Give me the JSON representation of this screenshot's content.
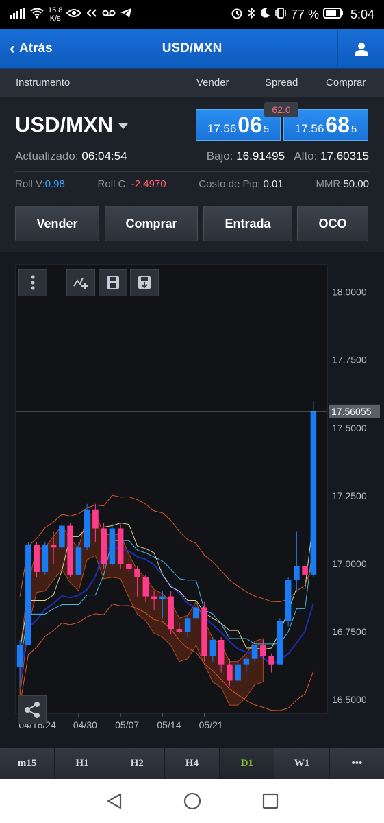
{
  "status_bar": {
    "net_speed": "15.8",
    "net_unit": "K/s",
    "battery": "77 %",
    "time": "5:04"
  },
  "nav": {
    "back_label": "Atrás",
    "title": "USD/MXN"
  },
  "columns": {
    "instrument": "Instrumento",
    "sell": "Vender",
    "spread": "Spread",
    "buy": "Comprar"
  },
  "instrument": {
    "name": "USD/MXN",
    "spread": "62.0",
    "sell_price": {
      "prefix": "17.56",
      "big": "06",
      "sup": "5"
    },
    "buy_price": {
      "prefix": "17.56",
      "big": "68",
      "sup": "5"
    },
    "updated_label": "Actualizado:",
    "updated_value": "06:04:54",
    "low_label": "Bajo:",
    "low_value": "16.91495",
    "high_label": "Alto:",
    "high_value": "17.60315",
    "roll_v_label": "Roll V:",
    "roll_v_value": "0.98",
    "roll_c_label": "Roll C:",
    "roll_c_value": "-2.4970",
    "pip_cost_label": "Costo de Pip:",
    "pip_cost_value": "0.01",
    "mmr_label": "MMR:",
    "mmr_value": "50.00"
  },
  "actions": {
    "sell": "Vender",
    "buy": "Comprar",
    "entry": "Entrada",
    "oco": "OCO"
  },
  "timeframes": [
    "m15",
    "H1",
    "H2",
    "H4",
    "D1",
    "W1",
    "•••"
  ],
  "active_timeframe": "D1",
  "chart_data": {
    "type": "candlestick",
    "y_ticks": [
      "18.0000",
      "17.7500",
      "17.5000",
      "17.2500",
      "17.0000",
      "16.7500",
      "16.5000"
    ],
    "x_ticks": [
      "04/16/24",
      "04/30",
      "05/07",
      "05/14",
      "05/21"
    ],
    "current_price_label": "17.56055",
    "current_price": 17.56055,
    "ylim": [
      16.45,
      18.1
    ],
    "candles": [
      {
        "o": 16.62,
        "h": 16.72,
        "c": 16.7,
        "l": 16.55
      },
      {
        "o": 16.7,
        "h": 17.08,
        "c": 17.07,
        "l": 16.7
      },
      {
        "o": 17.07,
        "h": 17.08,
        "c": 16.97,
        "l": 16.95
      },
      {
        "o": 16.97,
        "h": 17.08,
        "c": 17.07,
        "l": 16.96
      },
      {
        "o": 17.07,
        "h": 17.12,
        "c": 17.06,
        "l": 17.0
      },
      {
        "o": 17.06,
        "h": 17.15,
        "c": 17.14,
        "l": 17.05
      },
      {
        "o": 17.14,
        "h": 17.15,
        "c": 16.96,
        "l": 16.95
      },
      {
        "o": 16.96,
        "h": 17.08,
        "c": 17.06,
        "l": 16.96
      },
      {
        "o": 17.06,
        "h": 17.22,
        "c": 17.2,
        "l": 17.05
      },
      {
        "o": 17.2,
        "h": 17.22,
        "c": 17.13,
        "l": 17.08
      },
      {
        "o": 17.13,
        "h": 17.15,
        "c": 17.0,
        "l": 16.98
      },
      {
        "o": 17.0,
        "h": 17.15,
        "c": 17.13,
        "l": 16.99
      },
      {
        "o": 17.13,
        "h": 17.15,
        "c": 17.0,
        "l": 16.98
      },
      {
        "o": 17.0,
        "h": 17.02,
        "c": 16.98,
        "l": 16.97
      },
      {
        "o": 16.98,
        "h": 16.99,
        "c": 16.95,
        "l": 16.88
      },
      {
        "o": 16.95,
        "h": 16.96,
        "c": 16.88,
        "l": 16.86
      },
      {
        "o": 16.88,
        "h": 16.9,
        "c": 16.87,
        "l": 16.83
      },
      {
        "o": 16.87,
        "h": 16.9,
        "c": 16.88,
        "l": 16.8
      },
      {
        "o": 16.88,
        "h": 16.9,
        "c": 16.76,
        "l": 16.74
      },
      {
        "o": 16.76,
        "h": 16.78,
        "c": 16.75,
        "l": 16.74
      },
      {
        "o": 16.75,
        "h": 16.81,
        "c": 16.8,
        "l": 16.73
      },
      {
        "o": 16.8,
        "h": 16.86,
        "c": 16.84,
        "l": 16.78
      },
      {
        "o": 16.84,
        "h": 16.86,
        "c": 16.66,
        "l": 16.64
      },
      {
        "o": 16.66,
        "h": 16.73,
        "c": 16.72,
        "l": 16.64
      },
      {
        "o": 16.72,
        "h": 16.73,
        "c": 16.63,
        "l": 16.6
      },
      {
        "o": 16.63,
        "h": 16.65,
        "c": 16.57,
        "l": 16.55
      },
      {
        "o": 16.57,
        "h": 16.64,
        "c": 16.63,
        "l": 16.56
      },
      {
        "o": 16.63,
        "h": 16.66,
        "c": 16.65,
        "l": 16.6
      },
      {
        "o": 16.65,
        "h": 16.71,
        "c": 16.7,
        "l": 16.64
      },
      {
        "o": 16.7,
        "h": 16.72,
        "c": 16.66,
        "l": 16.65
      },
      {
        "o": 16.66,
        "h": 16.67,
        "c": 16.63,
        "l": 16.6
      },
      {
        "o": 16.63,
        "h": 16.8,
        "c": 16.79,
        "l": 16.63
      },
      {
        "o": 16.79,
        "h": 16.95,
        "c": 16.94,
        "l": 16.77
      },
      {
        "o": 16.94,
        "h": 17.12,
        "c": 16.99,
        "l": 16.9
      },
      {
        "o": 16.99,
        "h": 17.05,
        "c": 16.96,
        "l": 16.93
      },
      {
        "o": 16.96,
        "h": 17.6,
        "c": 17.56,
        "l": 16.95
      }
    ],
    "colors": {
      "up": "#1a7cf5",
      "down": "#ff3c8c",
      "cloud": "#6b2a14",
      "ma_blue": "#1a2fb0",
      "line_cyan": "#45b8e8",
      "line_yellow": "#d8d69a",
      "line_orange": "#d9562a"
    }
  }
}
